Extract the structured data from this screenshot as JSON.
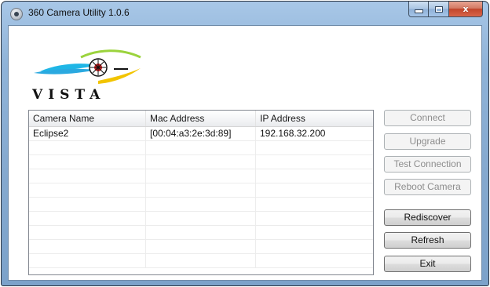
{
  "window": {
    "title": "360 Camera Utility 1.0.6",
    "controls": {
      "minimize_icon": "minimize-icon",
      "maximize_icon": "maximize-icon",
      "close_icon": "close-icon",
      "close_glyph": "x"
    }
  },
  "logo": {
    "text": "VISTA",
    "icon": "vista-eye-logo",
    "colors": [
      "#1fb6e6",
      "#f2c400",
      "#d11a1a",
      "#9bd33d"
    ]
  },
  "camera_list": {
    "columns": [
      "Camera Name",
      "Mac Address",
      "IP Address"
    ],
    "rows": [
      [
        "Eclipse2",
        "[00:04:a3:2e:3d:89]",
        "192.168.32.200"
      ]
    ]
  },
  "buttons": {
    "connect": {
      "label": "Connect",
      "enabled": false
    },
    "upgrade": {
      "label": "Upgrade",
      "enabled": false
    },
    "test_connection": {
      "label": "Test Connection",
      "enabled": false
    },
    "reboot_camera": {
      "label": "Reboot Camera",
      "enabled": false
    },
    "rediscover": {
      "label": "Rediscover",
      "enabled": true
    },
    "refresh": {
      "label": "Refresh",
      "enabled": true
    },
    "exit": {
      "label": "Exit",
      "enabled": true
    }
  }
}
